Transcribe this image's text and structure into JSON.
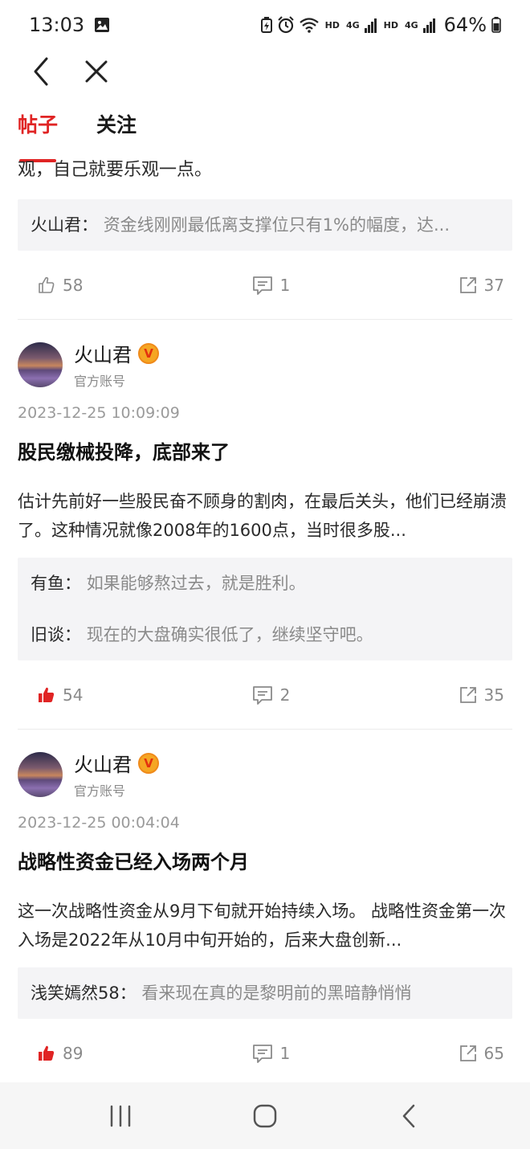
{
  "status_bar": {
    "time": "13:03",
    "signal_label_1": "HD",
    "signal_label_2": "HD",
    "network_1": "4G",
    "network_2": "4G",
    "battery_percent": "64%"
  },
  "tabs": [
    {
      "label": "帖子",
      "active": true
    },
    {
      "label": "关注",
      "active": false
    }
  ],
  "first_post_partial": {
    "trailing_text": "观，自己就要乐观一点。",
    "comments": [
      {
        "author": "火山君：",
        "text": "资金线刚刚最低离支撑位只有1%的幅度，达..."
      }
    ],
    "likes": "58",
    "comment_count": "1",
    "shares": "37",
    "liked": false
  },
  "posts": [
    {
      "author": "火山君",
      "badge": "V",
      "subtitle": "官方账号",
      "time": "2023-12-25 10:09:09",
      "title": "股民缴械投降，底部来了",
      "body": "估计先前好一些股民奋不顾身的割肉，在最后关头，他们已经崩溃了。这种情况就像2008年的1600点，当时很多股...",
      "comments": [
        {
          "author": "有鱼：",
          "text": "如果能够熬过去，就是胜利。"
        },
        {
          "author": "旧谈：",
          "text": "现在的大盘确实很低了，继续坚守吧。"
        }
      ],
      "likes": "54",
      "comment_count": "2",
      "shares": "35",
      "liked": true
    },
    {
      "author": "火山君",
      "badge": "V",
      "subtitle": "官方账号",
      "time": "2023-12-25 00:04:04",
      "title": "战略性资金已经入场两个月",
      "body": "这一次战略性资金从9月下旬就开始持续入场。 战略性资金第一次入场是2022年从10月中旬开始的，后来大盘创新...",
      "comments": [
        {
          "author": "浅笑嫣然58：",
          "text": "看来现在真的是黎明前的黑暗静悄悄"
        }
      ],
      "likes": "89",
      "comment_count": "1",
      "shares": "65",
      "liked": true
    }
  ],
  "colors": {
    "accent": "#e02424",
    "muted": "#8a8a8a",
    "comment_bg": "#f4f4f6",
    "badge": "#f5a623"
  },
  "icons": {
    "back": "back-arrow-icon",
    "close": "close-icon",
    "like": "thumbs-up-icon",
    "comment": "comment-icon",
    "share": "share-icon"
  }
}
